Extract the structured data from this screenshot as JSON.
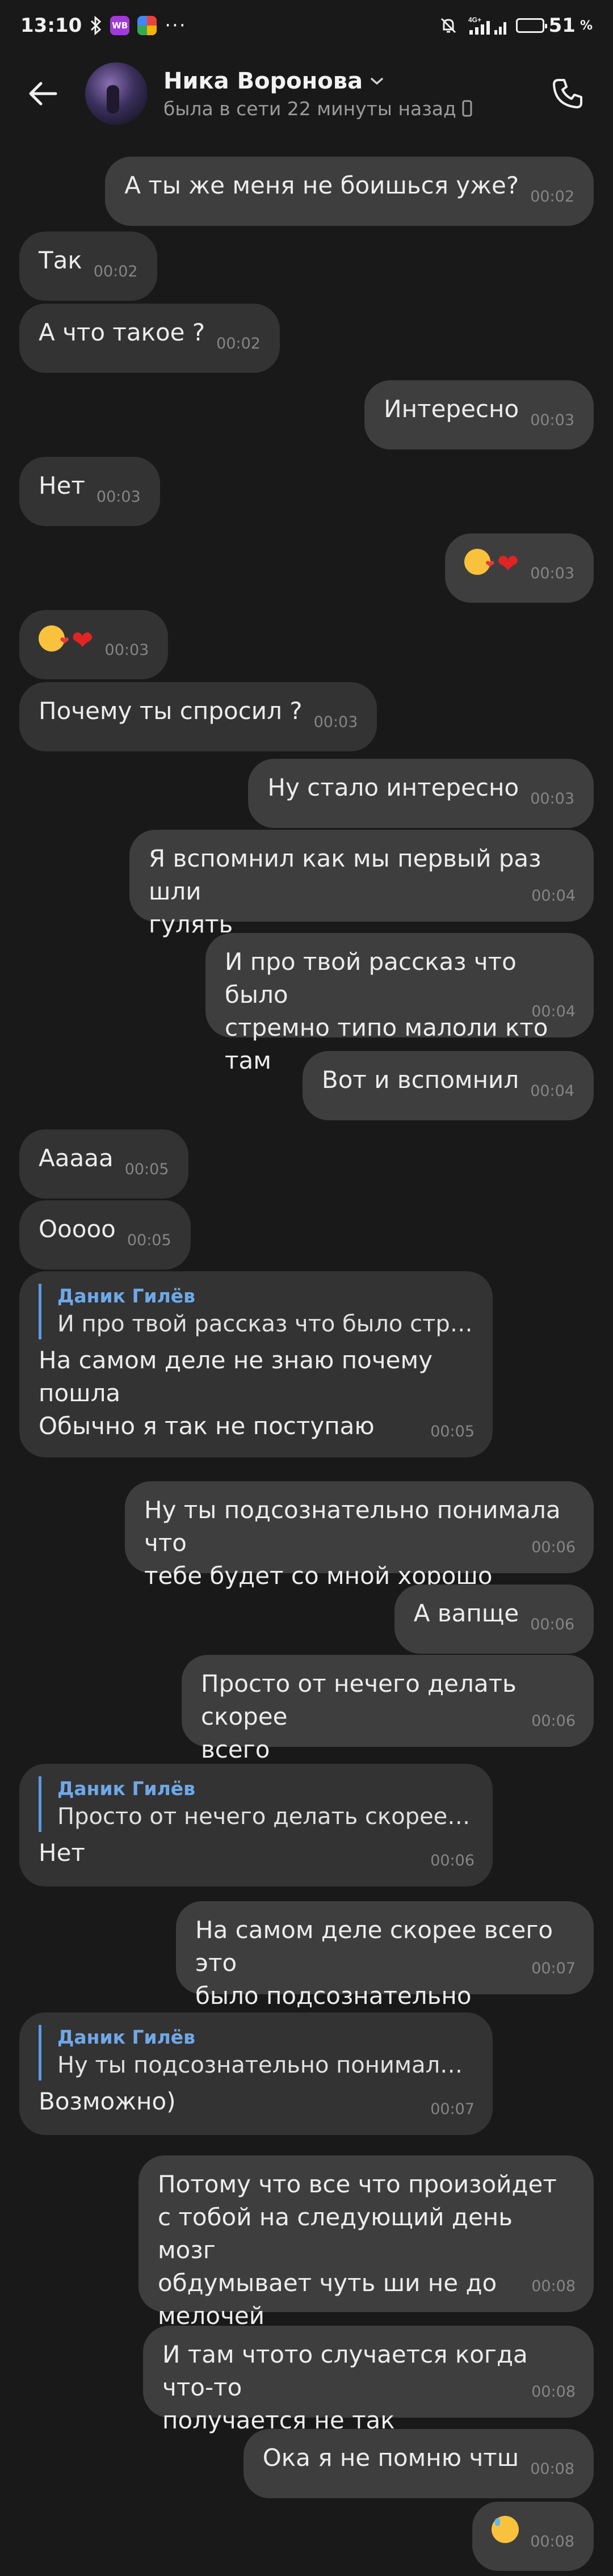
{
  "status_bar": {
    "time": "13:10",
    "icons": [
      "bluetooth-icon",
      "wb-app-icon",
      "pinwheel-app-icon",
      "more-dots-icon",
      "mute-icon",
      "signal-4g-icon",
      "signal-bars-icon",
      "battery-icon"
    ],
    "network": "4G+",
    "battery_percent": "51",
    "battery_unit": "%",
    "battery_level": 0.51,
    "colors": {
      "wb": "#a23ad6",
      "battery": "#3ddc56"
    }
  },
  "header": {
    "name": "Ника Воронова",
    "status": "была в сети 22 минуты назад"
  },
  "messages": [
    {
      "dir": "out",
      "text": "А ты же меня не боишься уже?",
      "time": "00:02"
    },
    {
      "dir": "in",
      "text": "Так",
      "time": "00:02"
    },
    {
      "dir": "in",
      "text": "А что такое ?",
      "time": "00:02"
    },
    {
      "dir": "out",
      "text": "Интересно",
      "time": "00:03"
    },
    {
      "dir": "in",
      "text": "Нет",
      "time": "00:03"
    },
    {
      "dir": "out",
      "text": "",
      "emoji": [
        "kissing-heart-emoji",
        "red-heart-emoji"
      ],
      "time": "00:03"
    },
    {
      "dir": "in",
      "text": "",
      "emoji": [
        "kissing-heart-emoji",
        "red-heart-emoji"
      ],
      "time": "00:03"
    },
    {
      "dir": "in",
      "text": "Почему ты спросил ?",
      "time": "00:03"
    },
    {
      "dir": "out",
      "text": "Ну стало интересно",
      "time": "00:03"
    },
    {
      "dir": "out",
      "text": "Я вспомнил как мы первый раз шли\nгулять",
      "time": "00:04"
    },
    {
      "dir": "out",
      "text": "И про твой рассказ что было\nстремно типо малоли кто там",
      "time": "00:04"
    },
    {
      "dir": "out",
      "text": "Вот и вспомнил",
      "time": "00:04"
    },
    {
      "dir": "in",
      "text": "Ааааа",
      "time": "00:05"
    },
    {
      "dir": "in",
      "text": "Ооооо",
      "time": "00:05"
    },
    {
      "dir": "in",
      "reply_author": "Даник Гилёв",
      "reply_text": "И про твой рассказ что было стремн…",
      "text": "На самом деле не знаю почему\nпошла\nОбычно я так не поступаю",
      "time": "00:05"
    },
    {
      "dir": "out",
      "text": "Ну ты подсознательно понимала что\nтебе будет со мной хорошо",
      "time": "00:06"
    },
    {
      "dir": "out",
      "text": "А вапще",
      "time": "00:06"
    },
    {
      "dir": "out",
      "text": "Просто от нечего делать скорее\nвсего",
      "time": "00:06"
    },
    {
      "dir": "in",
      "reply_author": "Даник Гилёв",
      "reply_text": "Просто от нечего делать скорее всего",
      "text": "Нет",
      "time": "00:06"
    },
    {
      "dir": "out",
      "text": "На самом деле скорее всего это\nбыло подсознательно",
      "time": "00:07"
    },
    {
      "dir": "in",
      "reply_author": "Даник Гилёв",
      "reply_text": "Ну ты подсознательно понимала чт…",
      "text": "Возможно)",
      "time": "00:07"
    },
    {
      "dir": "out",
      "text": "Потому что все что произойдет\nс тобой на следующий день мозг\nобдумывает чуть ши не до мелочей\nночью",
      "time": "00:08"
    },
    {
      "dir": "out",
      "text": "И там чтото случается когда что-то\nполучается не так",
      "time": "00:08"
    },
    {
      "dir": "out",
      "text": "Ока я не помню чтш",
      "time": "00:08"
    },
    {
      "dir": "out",
      "text": "",
      "emoji": [
        "sweat-smile-emoji"
      ],
      "time": "00:08"
    }
  ]
}
